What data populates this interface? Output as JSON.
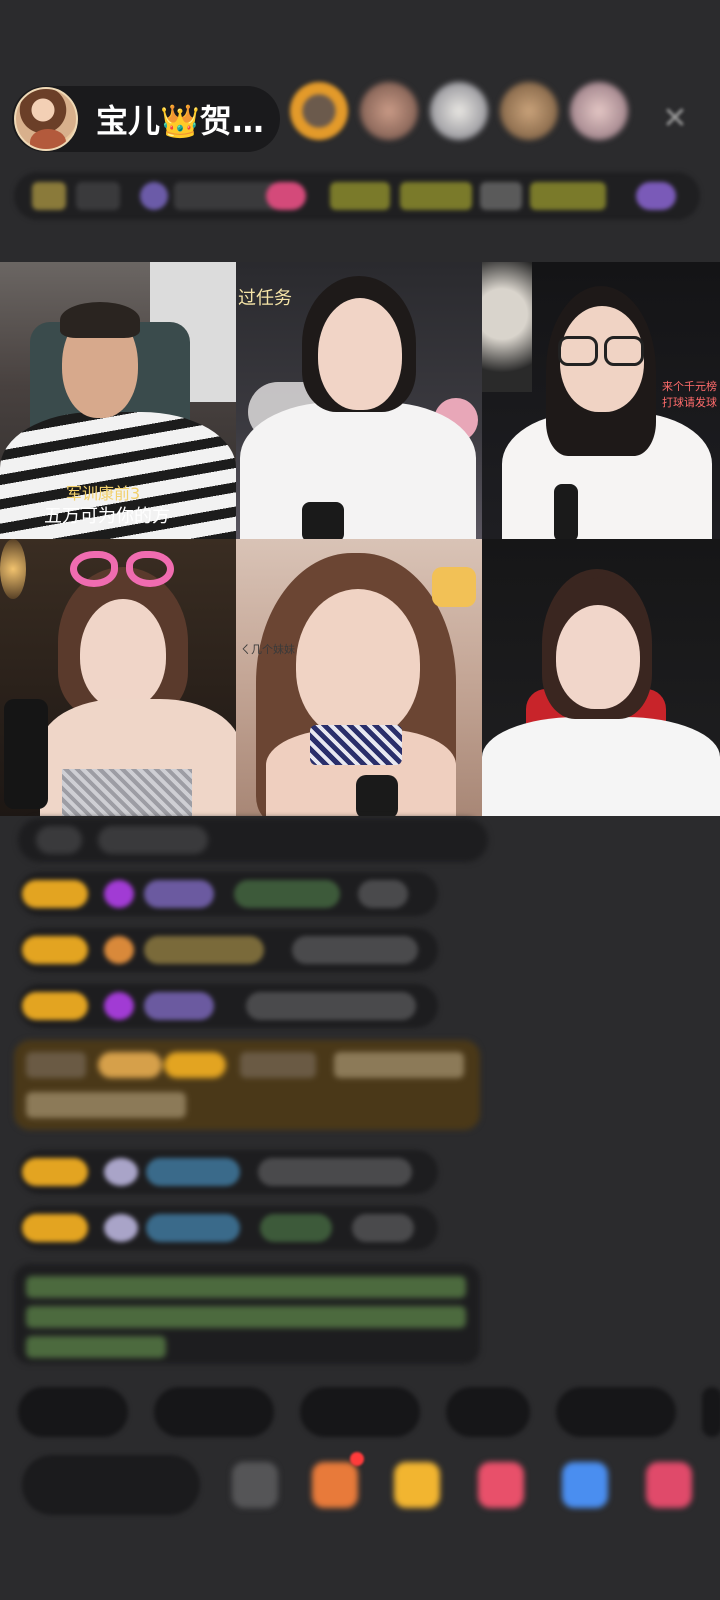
{
  "host": {
    "name": "宝儿👑贺…"
  },
  "grid": {
    "tile2_text": "过任务",
    "tile1_text_line1": "军训康前3",
    "tile1_text_line2": "五万可为你的方",
    "tile3_text_line1": "来个千元榜",
    "tile3_text_line2": "打球请发球",
    "tile5_text": "ㄑ几个妹妹"
  }
}
